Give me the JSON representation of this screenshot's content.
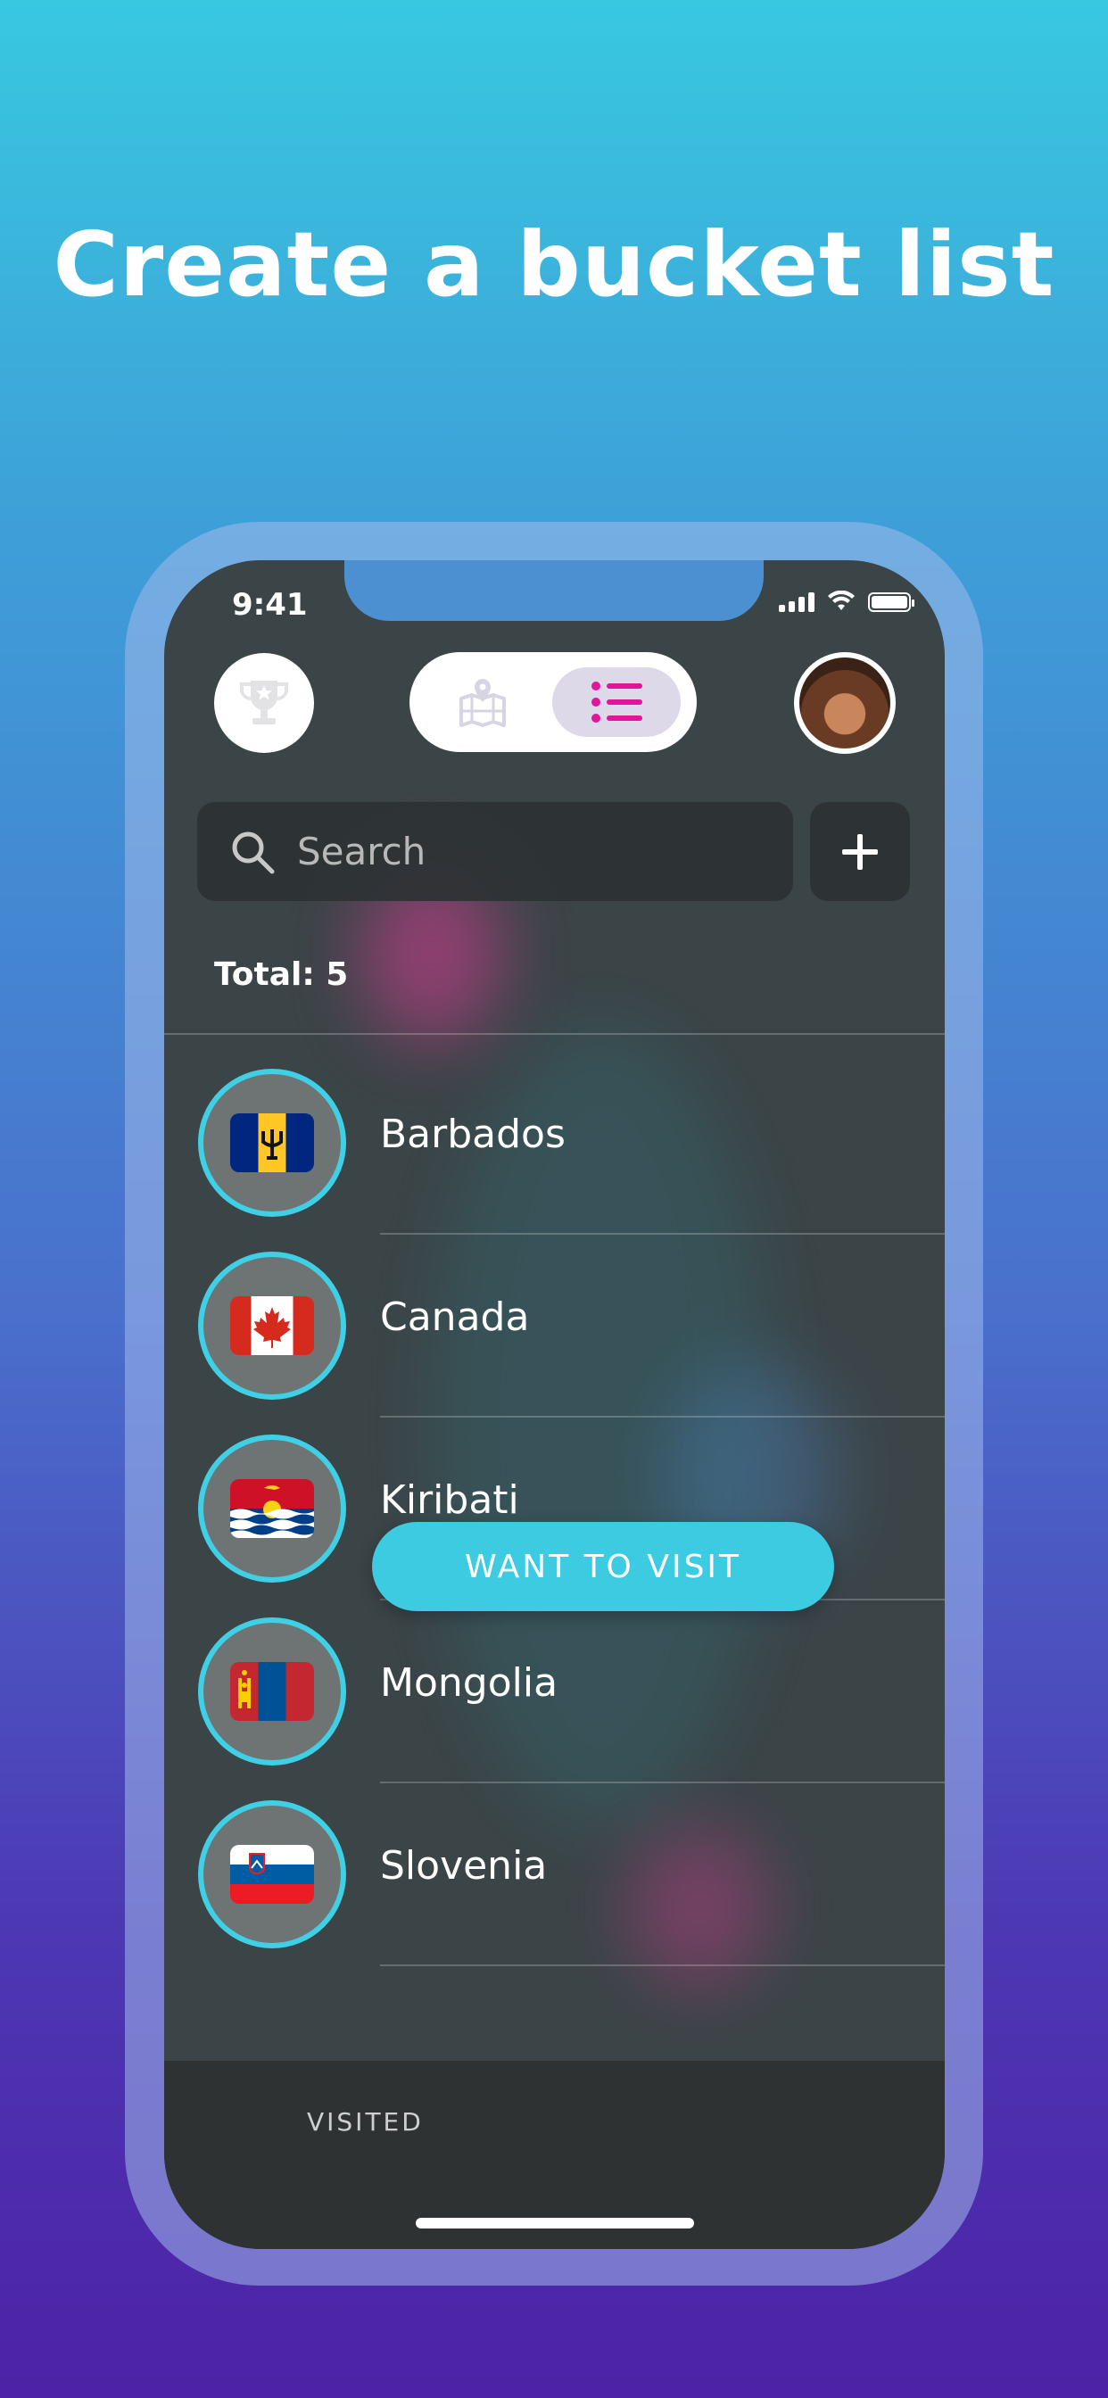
{
  "headline": "Create a bucket list",
  "status_bar": {
    "time": "9:41"
  },
  "search": {
    "placeholder": "Search"
  },
  "total_label": "Total: 5",
  "countries": [
    {
      "name": "Barbados",
      "flag_icon": "barbados-flag-icon"
    },
    {
      "name": "Canada",
      "flag_icon": "canada-flag-icon"
    },
    {
      "name": "Kiribati",
      "flag_icon": "kiribati-flag-icon"
    },
    {
      "name": "Mongolia",
      "flag_icon": "mongolia-flag-icon"
    },
    {
      "name": "Slovenia",
      "flag_icon": "slovenia-flag-icon"
    }
  ],
  "tabs": {
    "visited": "VISITED",
    "want_to_visit": "WANT TO VISIT"
  },
  "colors": {
    "accent": "#3ccbe0",
    "active_toggle_icon": "#e0159a"
  }
}
